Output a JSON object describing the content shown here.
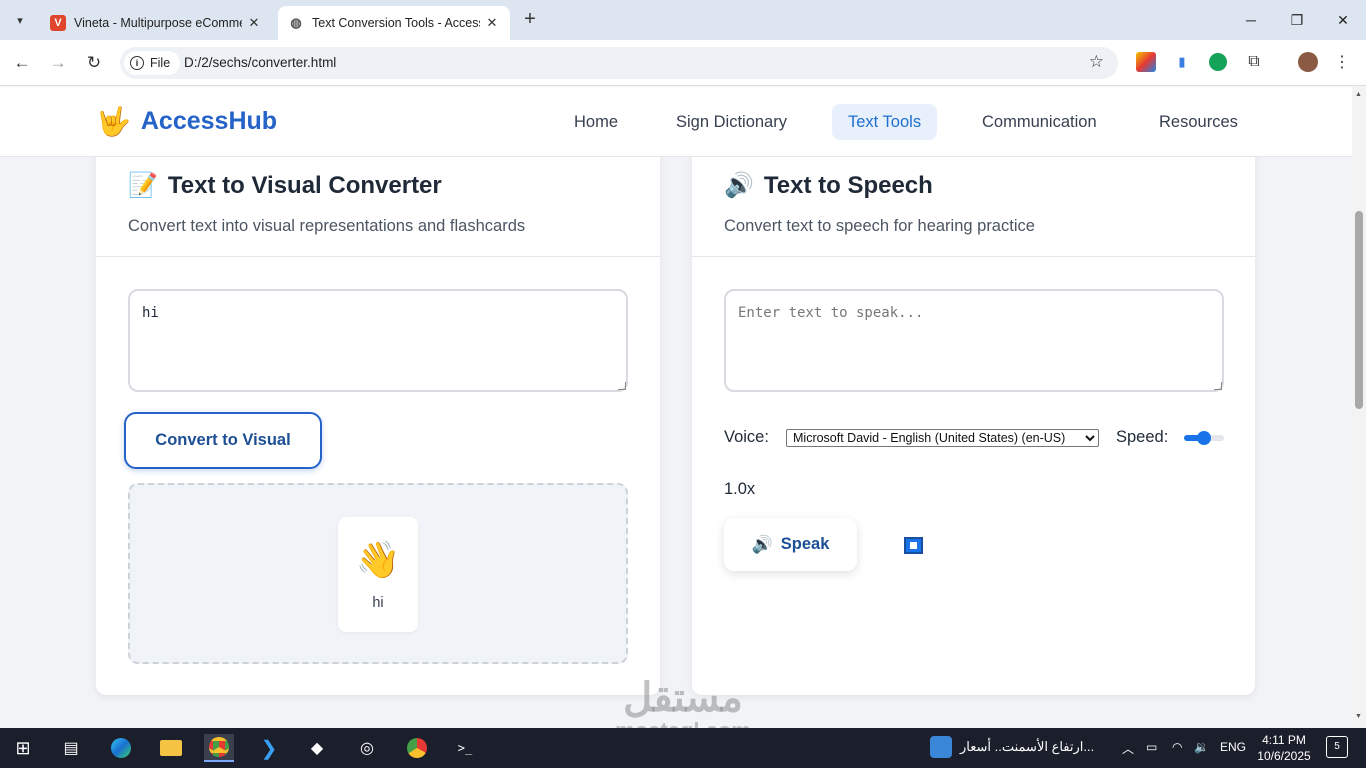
{
  "browser": {
    "tabs": [
      {
        "title": "Vineta - Multipurpose eComme",
        "active": false
      },
      {
        "title": "Text Conversion Tools - AccessH",
        "active": true
      }
    ],
    "new_tab": "+",
    "file_chip": "File",
    "url": "D:/2/sechs/converter.html"
  },
  "site": {
    "logo_emoji": "🤟",
    "logo_text": "AccessHub",
    "nav": [
      "Home",
      "Sign Dictionary",
      "Text Tools",
      "Communication",
      "Resources"
    ],
    "nav_active": "Text Tools"
  },
  "visual_converter": {
    "icon": "📝",
    "title": "Text to Visual Converter",
    "subtitle": "Convert text into visual representations and flashcards",
    "input_value": "hi",
    "button_label": "Convert to Visual",
    "flashcards": [
      {
        "emoji": "👋",
        "word": "hi"
      }
    ]
  },
  "text_to_speech": {
    "icon": "🔊",
    "title": "Text to Speech",
    "subtitle": "Convert text to speech for hearing practice",
    "input_placeholder": "Enter text to speak...",
    "voice_label": "Voice:",
    "voice_selected": "Microsoft David - English (United States) (en-US)",
    "speed_label": "Speed:",
    "speed_value": "1.0x",
    "speed_fraction": 0.5,
    "speak_icon": "🔊",
    "speak_label": "Speak",
    "stop_icon": "stop-icon"
  },
  "watermark": {
    "arabic": "مستقل",
    "latin": "mostaql.com"
  },
  "taskbar": {
    "news": "ارتفاع الأسمنت.. أسعار...",
    "language": "ENG",
    "time": "4:11 PM",
    "date": "10/6/2025",
    "notification_count": "5"
  },
  "colors": {
    "accent": "#2563c9",
    "nav_active_bg": "#e8f1fb",
    "slider": "#1a73e8"
  }
}
